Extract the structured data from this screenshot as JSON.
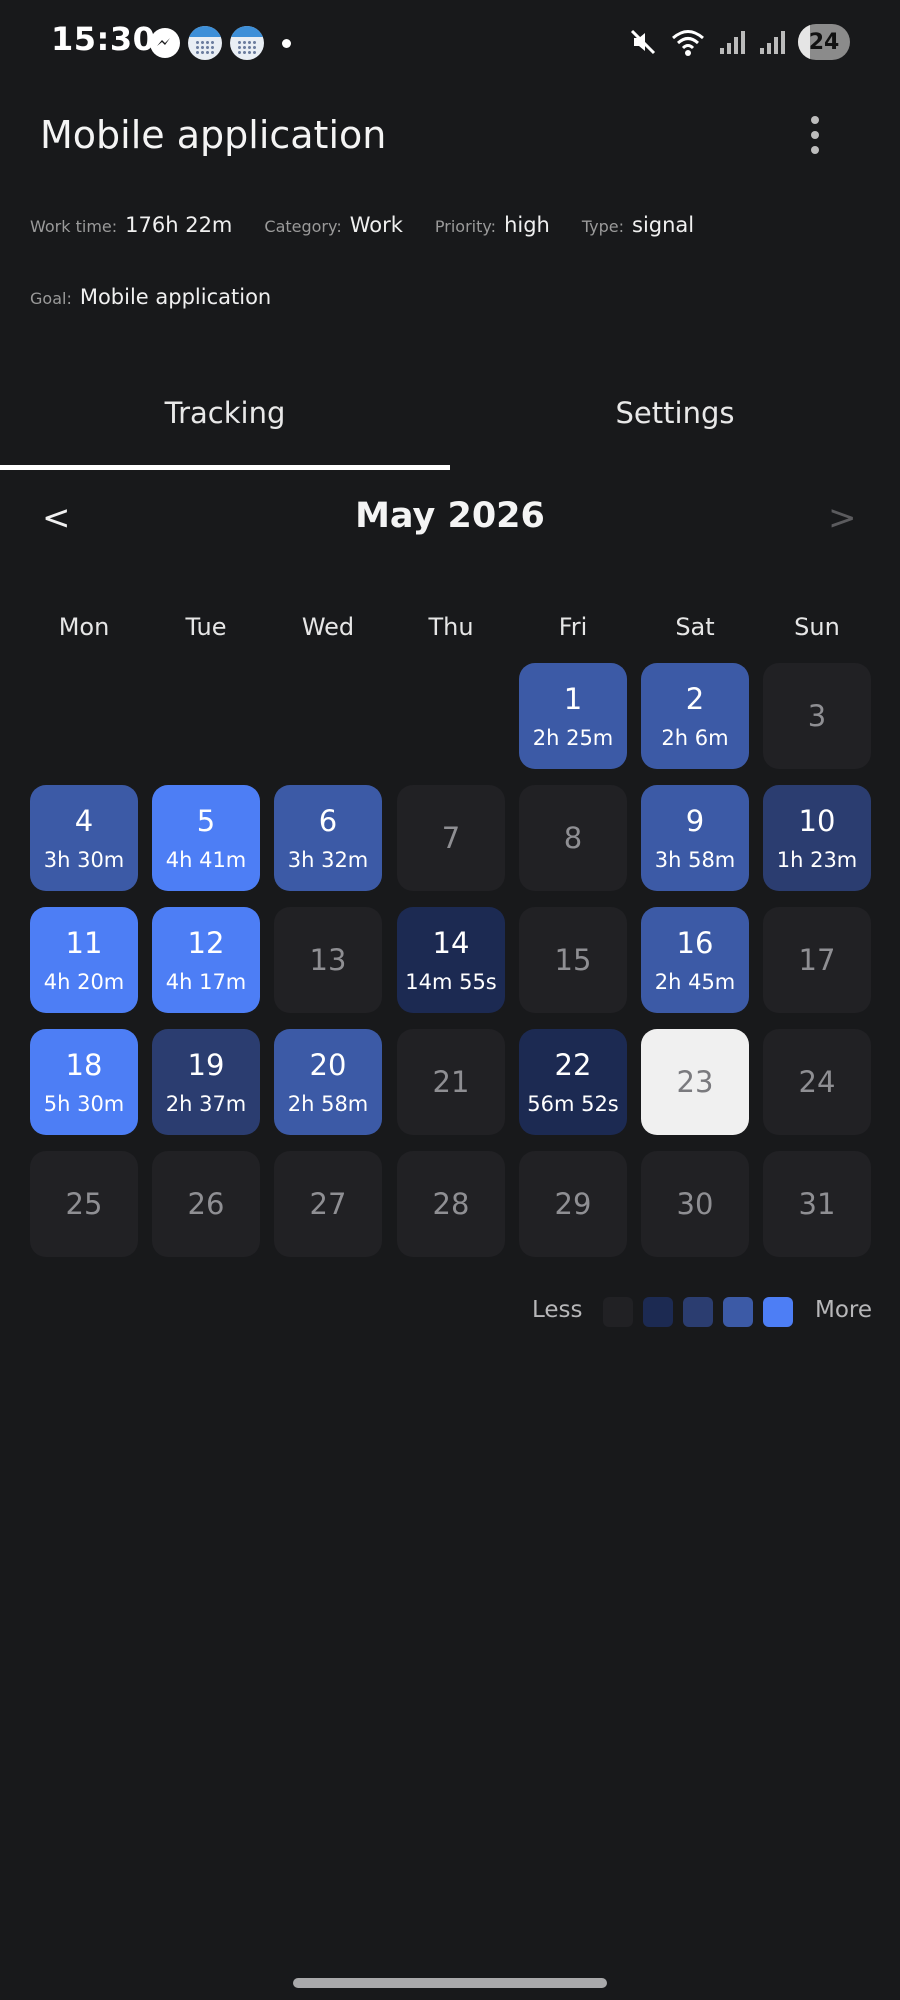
{
  "status_bar": {
    "time": "15:30",
    "battery": "24",
    "icons": [
      "messenger-icon",
      "calendar-icon",
      "calendar-icon",
      "dot-icon",
      "mute-icon",
      "wifi-icon",
      "signal-icon",
      "signal-icon"
    ]
  },
  "header": {
    "title": "Mobile application",
    "menu_icon": "more-vertical-icon"
  },
  "meta": {
    "work_time_label": "Work time:",
    "work_time_value": "176h 22m",
    "category_label": "Category:",
    "category_value": "Work",
    "priority_label": "Priority:",
    "priority_value": "high",
    "type_label": "Type:",
    "type_value": "signal",
    "goal_label": "Goal:",
    "goal_value": "Mobile application"
  },
  "tabs": [
    {
      "label": "Tracking",
      "active": true
    },
    {
      "label": "Settings",
      "active": false
    }
  ],
  "calendar": {
    "month": "May 2026",
    "prev": "<",
    "next": ">",
    "weekdays": [
      "Mon",
      "Tue",
      "Wed",
      "Thu",
      "Fri",
      "Sat",
      "Sun"
    ],
    "first_weekday_index": 4,
    "today": 23,
    "days": [
      {
        "day": "1",
        "duration": "2h 25m",
        "level": 3
      },
      {
        "day": "2",
        "duration": "2h 6m",
        "level": 3
      },
      {
        "day": "3",
        "duration": "",
        "level": 0
      },
      {
        "day": "4",
        "duration": "3h 30m",
        "level": 3
      },
      {
        "day": "5",
        "duration": "4h 41m",
        "level": 4
      },
      {
        "day": "6",
        "duration": "3h 32m",
        "level": 3
      },
      {
        "day": "7",
        "duration": "",
        "level": 0
      },
      {
        "day": "8",
        "duration": "",
        "level": 0
      },
      {
        "day": "9",
        "duration": "3h 58m",
        "level": 3
      },
      {
        "day": "10",
        "duration": "1h 23m",
        "level": 2
      },
      {
        "day": "11",
        "duration": "4h 20m",
        "level": 4
      },
      {
        "day": "12",
        "duration": "4h 17m",
        "level": 4
      },
      {
        "day": "13",
        "duration": "",
        "level": 0
      },
      {
        "day": "14",
        "duration": "14m 55s",
        "level": 1
      },
      {
        "day": "15",
        "duration": "",
        "level": 0
      },
      {
        "day": "16",
        "duration": "2h 45m",
        "level": 3
      },
      {
        "day": "17",
        "duration": "",
        "level": 0
      },
      {
        "day": "18",
        "duration": "5h 30m",
        "level": 4
      },
      {
        "day": "19",
        "duration": "2h 37m",
        "level": 2
      },
      {
        "day": "20",
        "duration": "2h 58m",
        "level": 3
      },
      {
        "day": "21",
        "duration": "",
        "level": 0
      },
      {
        "day": "22",
        "duration": "56m 52s",
        "level": 1
      },
      {
        "day": "23",
        "duration": "",
        "level": 0
      },
      {
        "day": "24",
        "duration": "",
        "level": 0
      },
      {
        "day": "25",
        "duration": "",
        "level": 0
      },
      {
        "day": "26",
        "duration": "",
        "level": 0
      },
      {
        "day": "27",
        "duration": "",
        "level": 0
      },
      {
        "day": "28",
        "duration": "",
        "level": 0
      },
      {
        "day": "29",
        "duration": "",
        "level": 0
      },
      {
        "day": "30",
        "duration": "",
        "level": 0
      },
      {
        "day": "31",
        "duration": "",
        "level": 0
      }
    ]
  },
  "legend": {
    "less": "Less",
    "more": "More"
  },
  "colors": {
    "background": "#18191b",
    "level_0": "#212124",
    "level_1": "#1c2a52",
    "level_2": "#2b3d70",
    "level_3": "#3c5aa6",
    "level_4": "#4d7ef5",
    "today": "#f0f0f0",
    "active_tab_indicator": "#ffffff"
  }
}
